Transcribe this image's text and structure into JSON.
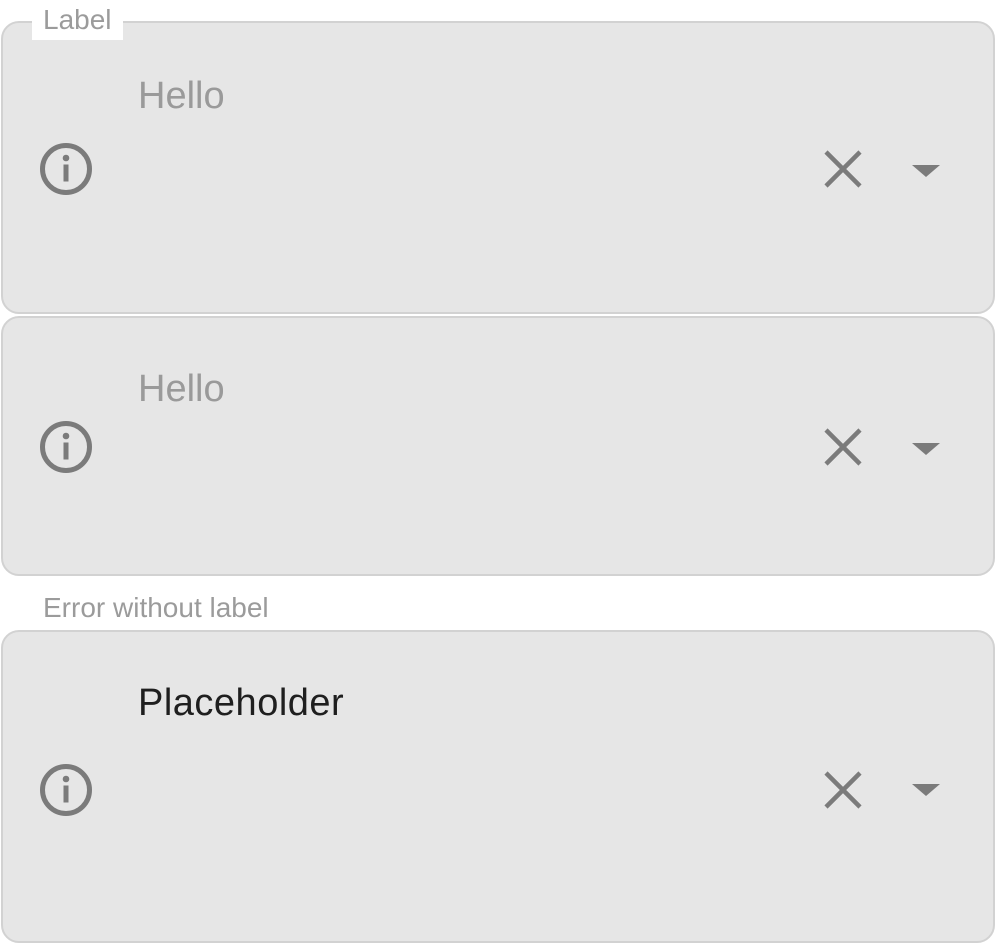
{
  "fields": [
    {
      "label": "Label",
      "value": "Hello",
      "icons": {
        "leading": "info-icon",
        "clear": "close-icon",
        "dropdown": "caret-down-icon"
      }
    },
    {
      "value": "Hello",
      "icons": {
        "leading": "info-icon",
        "clear": "close-icon",
        "dropdown": "caret-down-icon"
      }
    },
    {
      "label": "Error without label",
      "value": "Placeholder",
      "icons": {
        "leading": "info-icon",
        "clear": "close-icon",
        "dropdown": "caret-down-icon"
      }
    }
  ],
  "colors": {
    "field_background": "#e6e6e6",
    "field_border": "#d2d2d2",
    "icon": "#7b7b7b",
    "label_text": "#9b9b9b",
    "muted_value_text": "#9a9a9a",
    "value_text": "#1f1f1f"
  }
}
